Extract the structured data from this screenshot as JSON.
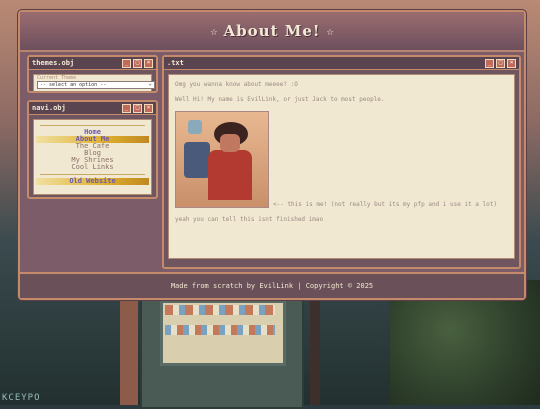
{
  "header": {
    "title": "About Me!",
    "star": "☆"
  },
  "themes": {
    "title": "themes.obj",
    "label": "Current Theme",
    "select_value": "-- select an option --",
    "buttons": [
      "_",
      "□",
      "×"
    ]
  },
  "navi": {
    "title": "navi.obj",
    "buttons": [
      "_",
      "□",
      "×"
    ],
    "items": [
      {
        "label": "Home"
      },
      {
        "label": "About Me"
      },
      {
        "label": "The Cafe"
      },
      {
        "label": "Blog"
      },
      {
        "label": "My Shrines"
      },
      {
        "label": "Cool Links"
      }
    ],
    "old_website": "Old Website"
  },
  "txt": {
    "title": ".txt",
    "buttons": [
      "_",
      "□",
      "×"
    ],
    "p1": "Omg you wanna know about meeee? :O",
    "p2": "Well Hi! My name is EvilLink, or just Jack to most people.",
    "caption": "<-- this is me! (not really but its my pfp and i use it a lot)",
    "p3": "yeah you can tell this isnt finished imao"
  },
  "footer": {
    "text": "Made from scratch by EvilLink | Copyright © 2025"
  },
  "watermark": "KCEYPO",
  "colors": {
    "accent": "#c58a6a",
    "panel": "#6f5560",
    "paper": "#f1e8d2"
  }
}
